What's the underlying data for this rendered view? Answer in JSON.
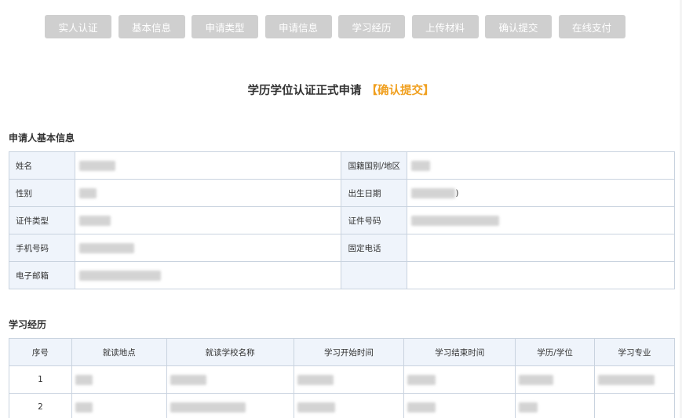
{
  "steps": [
    "实人认证",
    "基本信息",
    "申请类型",
    "申请信息",
    "学习经历",
    "上传材料",
    "确认提交",
    "在线支付"
  ],
  "title": {
    "main": "学历学位认证正式申请",
    "highlight": "【确认提交】"
  },
  "applicant": {
    "section_title": "申请人基本信息",
    "rows": [
      {
        "l1": "姓名",
        "l2": "国籍国别/地区"
      },
      {
        "l1": "性别",
        "l2": "出生日期",
        "v2_tail": ")"
      },
      {
        "l1": "证件类型",
        "l2": "证件号码"
      },
      {
        "l1": "手机号码",
        "l2": "固定电话"
      },
      {
        "l1": "电子邮箱"
      }
    ]
  },
  "education": {
    "section_title": "学习经历",
    "headers": [
      "序号",
      "就读地点",
      "就读学校名称",
      "学习开始时间",
      "学习结束时间",
      "学历/学位",
      "学习专业"
    ],
    "rows": [
      {
        "index": "1"
      },
      {
        "index": "2"
      }
    ]
  },
  "colors": {
    "accent": "#f0a020",
    "step_bg": "#cfcfcf",
    "label_bg": "#eff4fb",
    "border": "#c9d3df"
  }
}
